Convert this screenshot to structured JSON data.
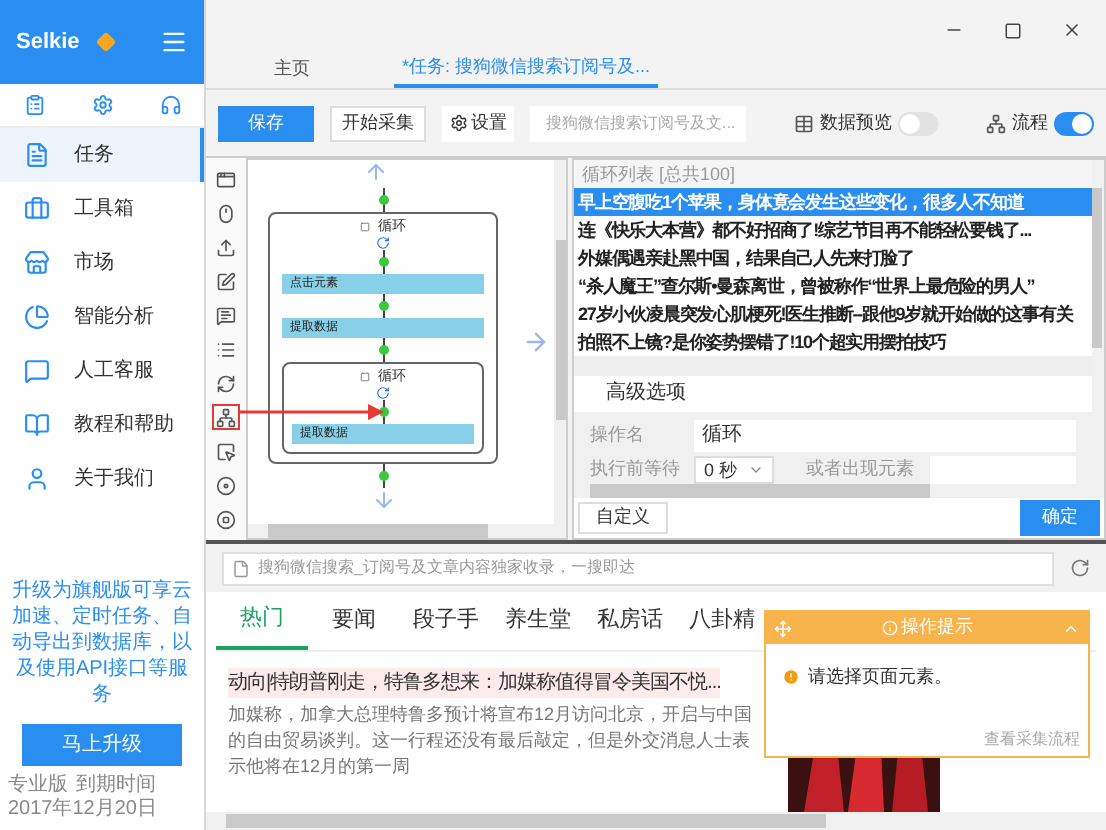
{
  "sidebar": {
    "brand": "Selkie",
    "items": [
      {
        "label": "任务",
        "selected": true
      },
      {
        "label": "工具箱",
        "selected": false
      },
      {
        "label": "市场",
        "selected": false
      },
      {
        "label": "智能分析",
        "selected": false
      },
      {
        "label": "人工客服",
        "selected": false
      },
      {
        "label": "教程和帮助",
        "selected": false
      },
      {
        "label": "关于我们",
        "selected": false
      }
    ],
    "promo": "升级为旗舰版可享云加速、定时任务、自动导出到数据库，以及使用API接口等服务",
    "upgrade_button": "马上升级",
    "footer": {
      "edition": "专业版",
      "expiry_label": "到期时间",
      "expiry_date": "2017年12月20日"
    }
  },
  "tabs": [
    {
      "label": "主页",
      "selected": false
    },
    {
      "label": "*任务: 搜狗微信搜索订阅号及...",
      "selected": true
    }
  ],
  "toolbar": {
    "save": "保存",
    "start": "开始采集",
    "settings": "设置",
    "task_field": {
      "placeholder": "搜狗微信搜索订阅号及文..."
    },
    "toggles": [
      {
        "label": "数据预览",
        "on": false
      },
      {
        "label": "流程",
        "on": true
      }
    ]
  },
  "tools": [
    {
      "highlighted": false
    },
    {
      "highlighted": false
    },
    {
      "highlighted": false
    },
    {
      "highlighted": false
    },
    {
      "highlighted": false
    },
    {
      "highlighted": false
    },
    {
      "highlighted": false
    },
    {
      "highlighted": true
    },
    {
      "highlighted": false
    },
    {
      "highlighted": false
    },
    {
      "highlighted": false
    }
  ],
  "flow": {
    "loop": {
      "title": "循环",
      "steps": [
        "点击元素",
        "提取数据"
      ],
      "inner_loop": {
        "title": "循环",
        "steps": [
          "提取数据"
        ]
      }
    }
  },
  "loop_list": {
    "title": "循环列表 [总共100]",
    "items": [
      {
        "text": "早上空腹吃1个苹果，身体竟会发生这些变化，很多人不知道",
        "selected": true
      },
      {
        "text": "连《快乐大本营》都不好招商了!综艺节目再不能轻松要钱了...",
        "selected": false
      },
      {
        "text": "外媒偶遇亲赴黑中国，结果自己人先来打脸了",
        "selected": false
      },
      {
        "text": "“杀人魔王”查尔斯•曼森离世，曾被称作“世界上最危险的男人”",
        "selected": false
      },
      {
        "text": "27岁小伙凌晨突发心肌梗死!医生推断--跟他9岁就开始做的这事有关",
        "selected": false
      },
      {
        "text": "拍照不上镜?是你姿势摆错了!10个超实用摆拍技巧",
        "selected": false
      }
    ]
  },
  "advanced": {
    "title": "高级选项",
    "name_label": "操作名",
    "name_value": "循环",
    "wait_label": "执行前等待",
    "wait_value": "0 秒",
    "or_label": "或者出现元素"
  },
  "panel_buttons": {
    "custom": "自定义",
    "confirm": "确定"
  },
  "browser": {
    "address": "搜狗微信搜索_订阅号及文章内容独家收录，一搜即达",
    "news_tabs": [
      {
        "label": "热门",
        "selected": true
      },
      {
        "label": "要闻",
        "selected": false
      },
      {
        "label": "段子手",
        "selected": false
      },
      {
        "label": "养生堂",
        "selected": false
      },
      {
        "label": "私房话",
        "selected": false
      },
      {
        "label": "八卦精",
        "selected": false
      }
    ],
    "article": {
      "title": "动向|特朗普刚走，特鲁多想来：加媒称值得冒令美国不悦...",
      "body": "加媒称，加拿大总理特鲁多预计将宣布12月访问北京，开启与中国的自由贸易谈判。这一行程还没有最后敲定，但是外交消息人士表示他将在12月的第一周"
    }
  },
  "tip_popup": {
    "title": "操作提示",
    "message": "请选择页面元素。",
    "link": "查看采集流程"
  }
}
